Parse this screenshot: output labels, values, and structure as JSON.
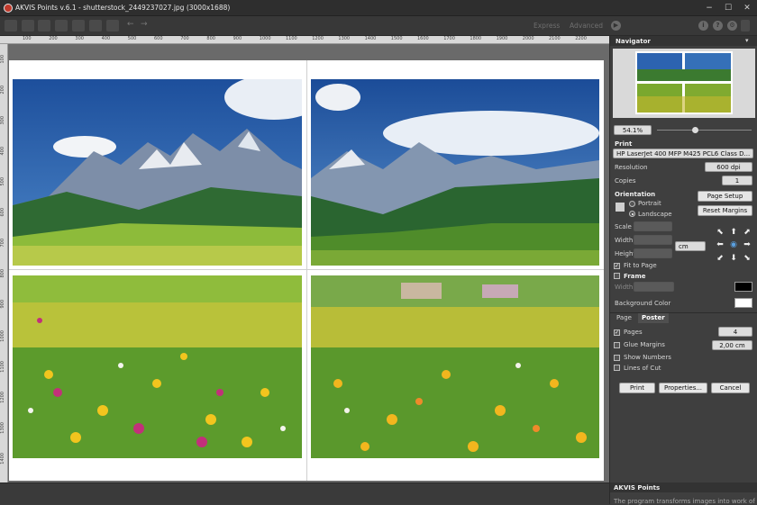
{
  "window": {
    "title": "AKVIS Points v.6.1 - shutterstock_2449237027.jpg (3000x1688)",
    "controls": [
      "−",
      "☐",
      "✕"
    ]
  },
  "toolbar": {
    "mode_express": "Express",
    "mode_advanced": "Advanced",
    "undo": "←",
    "redo": "→",
    "info": "i",
    "help": "?",
    "settings": "⚙"
  },
  "ruler": {
    "top_ticks": [
      "100",
      "200",
      "300",
      "400",
      "500",
      "600",
      "700",
      "800",
      "900",
      "1000",
      "1100",
      "1200",
      "1300",
      "1400",
      "1500",
      "1600",
      "1700",
      "1800",
      "1900",
      "2000",
      "2100",
      "2200"
    ],
    "left_ticks": [
      "100",
      "200",
      "300",
      "400",
      "500",
      "600",
      "700",
      "800",
      "900",
      "1000",
      "1100",
      "1200",
      "1300",
      "1400"
    ]
  },
  "navigator": {
    "title": "Navigator",
    "collapse": "▾",
    "zoom_value": "54.1%"
  },
  "print": {
    "section_label": "Print",
    "printer": "HP LaserJet 400 MFP M425 PCL6 Class D...",
    "resolution_label": "Resolution",
    "resolution_value": "600 dpi",
    "copies_label": "Copies",
    "copies_value": "1",
    "orientation_label": "Orientation",
    "portrait_label": "Portrait",
    "landscape_label": "Landscape",
    "page_setup_label": "Page Setup",
    "reset_margins_label": "Reset Margins",
    "scale_label": "Scale",
    "width_label": "Width",
    "height_label": "Height",
    "unit_value": "cm",
    "fit_to_page_label": "Fit to Page",
    "fit_to_page_checked": "✓",
    "frame_label": "Frame",
    "frame_width_label": "Width",
    "frame_color": "#000000",
    "background_color_label": "Background Color",
    "background_color": "#ffffff"
  },
  "tabs": {
    "page": "Page",
    "poster": "Poster"
  },
  "poster": {
    "pages_label": "Pages",
    "pages_checked": "✓",
    "pages_value": "4",
    "glue_margins_label": "Glue Margins",
    "glue_margins_value": "2,00 cm",
    "show_numbers_label": "Show Numbers",
    "lines_of_cut_label": "Lines of Cut"
  },
  "actions": {
    "print": "Print",
    "properties": "Properties...",
    "cancel": "Cancel"
  },
  "about": {
    "title": "AKVIS Points",
    "text": "The program transforms images into work of art"
  },
  "colors": {
    "accent": "#c0392b",
    "panel": "#3f3f3f",
    "workarea": "#6a6a6a"
  }
}
